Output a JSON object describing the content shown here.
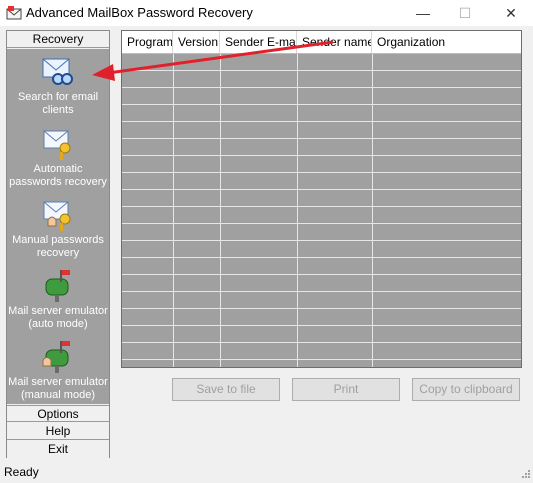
{
  "window": {
    "title": "Advanced MailBox Password Recovery",
    "min": "—",
    "max": "☐",
    "close": "✕"
  },
  "sidebar": {
    "top_tab": "Recovery",
    "items": [
      {
        "label": "Search for email clients",
        "icon": "search-email-icon"
      },
      {
        "label": "Automatic passwords recovery",
        "icon": "auto-key-icon"
      },
      {
        "label": "Manual passwords recovery",
        "icon": "manual-key-icon"
      },
      {
        "label": "Mail server emulator (auto mode)",
        "icon": "mailbox-auto-icon"
      },
      {
        "label": "Mail server emulator (manual mode)",
        "icon": "mailbox-manual-icon"
      }
    ],
    "bottom_tabs": [
      "Options",
      "Help",
      "Exit"
    ]
  },
  "table": {
    "columns": [
      "Program",
      "Version",
      "Sender E-mail",
      "Sender name",
      "Organization"
    ]
  },
  "buttons": {
    "save": "Save to file",
    "print": "Print",
    "copy": "Copy to clipboard"
  },
  "status": {
    "text": "Ready"
  },
  "colors": {
    "panel": "#a0a0a0",
    "grid": "#a0a0a0",
    "arrow": "#e0202a"
  }
}
